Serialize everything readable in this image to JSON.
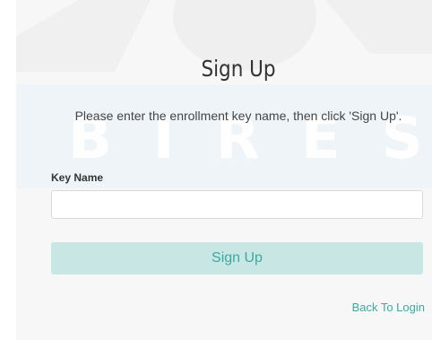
{
  "page": {
    "title": "Sign Up",
    "instructions": "Please enter the enrollment key name, then click 'Sign Up'."
  },
  "form": {
    "key_name_label": "Key Name",
    "key_name_value": "",
    "key_name_placeholder": ""
  },
  "actions": {
    "signup_label": "Sign Up",
    "back_to_login_label": "Back To Login"
  },
  "watermark": {
    "text": "BIRES"
  },
  "colors": {
    "accent": "#3ea8a2",
    "button_background": "#c8e6e4",
    "panel_background": "#f7f7f7",
    "watermark_band": "#eef4f8"
  }
}
